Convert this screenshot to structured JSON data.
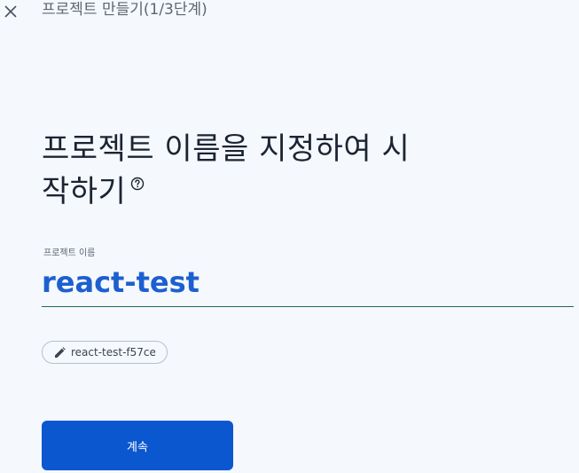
{
  "header": {
    "title": "프로젝트 만들기(1/3단계)",
    "close_icon": "close-icon"
  },
  "main": {
    "heading_line1": "프로젝트 이름을 지정하여 시",
    "heading_line2": "작하기",
    "help_icon": "help-circle-icon"
  },
  "form": {
    "project_name_label": "프로젝트 이름",
    "project_name_value": "react-test",
    "project_id_chip": "react-test-f57ce",
    "chip_icon": "edit-pencil-icon"
  },
  "actions": {
    "continue_label": "계속"
  },
  "colors": {
    "background": "#f5f8fc",
    "accent": "#0b57d0",
    "input_text": "#1c5fd0",
    "input_underline": "#1e6b53"
  }
}
